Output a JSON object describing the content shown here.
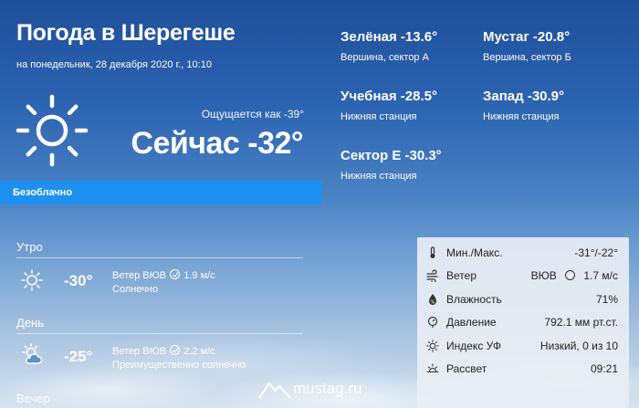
{
  "header": {
    "title": "Погода в Шерегеше",
    "date": "на понедельник, 28 декабря 2020 г., 10:10"
  },
  "current": {
    "icon": "sun-icon",
    "feels_like": "Ощущается как -39°",
    "now": "Сейчас -32°",
    "condition": "Безоблачно"
  },
  "stations": [
    {
      "name": "Зелёная -13.6°",
      "sub": "Вершина, сектор А"
    },
    {
      "name": "Мустаг -20.8°",
      "sub": "Вершина, сектор Б"
    },
    {
      "name": "Учебная -28.5°",
      "sub": "Нижняя станция"
    },
    {
      "name": "Запад -30.9°",
      "sub": "Нижняя станция"
    },
    {
      "name": "Сектор Е -30.3°",
      "sub": "Нижняя станция"
    }
  ],
  "periods": [
    {
      "title": "Утро",
      "icon": "sun-icon",
      "temp": "-30°",
      "wind_prefix": "Ветер ВЮВ",
      "wind_speed": "1.9 м/с",
      "desc": "Солнечно"
    },
    {
      "title": "День",
      "icon": "sun-cloud-icon",
      "temp": "-25°",
      "wind_prefix": "Ветер ВЮВ",
      "wind_speed": "2.2 м/с",
      "desc": "Преимущественно солнечно"
    },
    {
      "title": "Вечер"
    }
  ],
  "details": [
    {
      "icon": "thermometer-icon",
      "label": "Мин./Макс.",
      "value": "-31°/-22°"
    },
    {
      "icon": "wind-icon",
      "label": "Ветер",
      "value": "ВЮВ",
      "value2": "1.7 м/с"
    },
    {
      "icon": "humidity-icon",
      "label": "Влажность",
      "value": "71%"
    },
    {
      "icon": "pressure-icon",
      "label": "Давление",
      "value": "792.1 мм рт.ст."
    },
    {
      "icon": "uv-icon",
      "label": "Индекс УФ",
      "value": "Низкий, 0 из 10"
    },
    {
      "icon": "sunrise-icon",
      "label": "Рассвет",
      "value": "09:21"
    }
  ],
  "logo": {
    "text": "mustag.ru"
  },
  "colors": {
    "condition_bar": "#1e90f0",
    "details_bg": "#e9eef5"
  }
}
